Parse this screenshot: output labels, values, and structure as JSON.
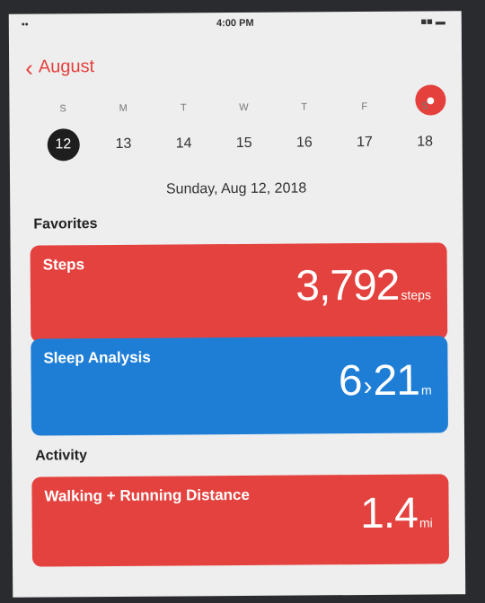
{
  "status_bar": {
    "carrier": "••",
    "time": "4:00 PM",
    "battery": "■■ ▬"
  },
  "nav": {
    "back_label": "August"
  },
  "calendar": {
    "weekdays": [
      "S",
      "M",
      "T",
      "W",
      "T",
      "F",
      "S"
    ],
    "days": [
      "12",
      "13",
      "14",
      "15",
      "16",
      "17",
      "18"
    ],
    "selected_index": 0,
    "date_label": "Sunday, Aug 12, 2018"
  },
  "favorites": {
    "title": "Favorites",
    "steps": {
      "title": "Steps",
      "value": "3,792",
      "unit": "steps"
    },
    "sleep": {
      "title": "Sleep Analysis",
      "value": "6",
      "value2": "21",
      "unit": "m"
    }
  },
  "activity": {
    "title": "Activity",
    "walking": {
      "title": "Walking + Running Distance",
      "value": "1.4",
      "unit": "mi"
    }
  },
  "colors": {
    "accent_red": "#e4423e",
    "accent_blue": "#1e7ed6",
    "selected_day": "#1e1e1e"
  }
}
